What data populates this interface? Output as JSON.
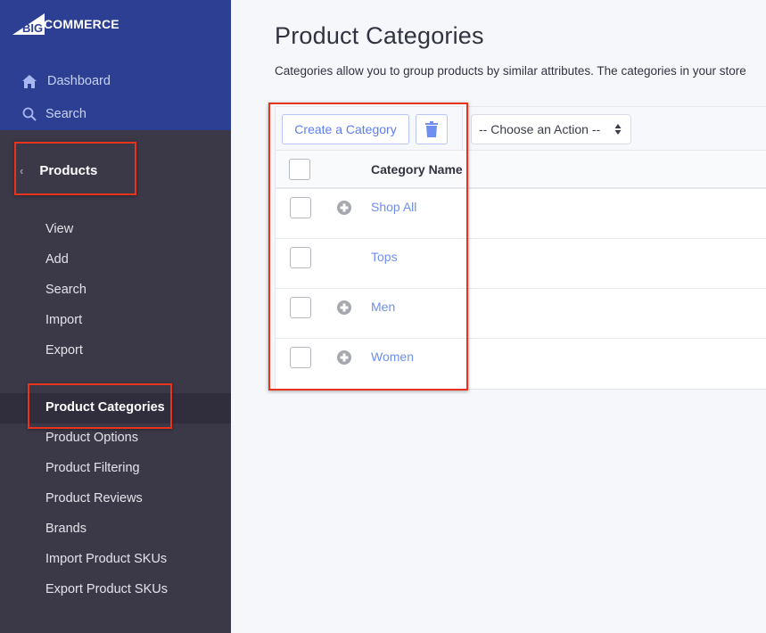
{
  "brand": {
    "logo_text_big": "BIG",
    "logo_text_rest": "COMMERCE"
  },
  "sidebar": {
    "top_nav": [
      {
        "label": "Dashboard",
        "icon": "home-icon"
      },
      {
        "label": "Search",
        "icon": "search-icon"
      }
    ],
    "section": {
      "label": "Products",
      "back_icon": "chevron-left-icon"
    },
    "sub_items": [
      {
        "label": "View"
      },
      {
        "label": "Add"
      },
      {
        "label": "Search"
      },
      {
        "label": "Import"
      },
      {
        "label": "Export"
      },
      {
        "label": "Product Categories",
        "active": true
      },
      {
        "label": "Product Options"
      },
      {
        "label": "Product Filtering"
      },
      {
        "label": "Product Reviews"
      },
      {
        "label": "Brands"
      },
      {
        "label": "Import Product SKUs"
      },
      {
        "label": "Export Product SKUs"
      }
    ]
  },
  "main": {
    "title": "Product Categories",
    "description": "Categories allow you to group products by similar attributes. The categories in your store",
    "toolbar": {
      "create_label": "Create a Category",
      "delete_icon": "trash-icon",
      "action_select": {
        "selected": "-- Choose an Action --"
      }
    },
    "table": {
      "columns": [
        "Category Name"
      ],
      "rows": [
        {
          "name": "Shop All",
          "has_children": true
        },
        {
          "name": "Tops",
          "has_children": false
        },
        {
          "name": "Men",
          "has_children": true
        },
        {
          "name": "Women",
          "has_children": true
        }
      ]
    }
  },
  "colors": {
    "sidebar_blue": "#2c3f92",
    "sidebar_dark": "#3b3948",
    "accent_link": "#6e8ff0",
    "highlight_box": "#e8341c"
  }
}
